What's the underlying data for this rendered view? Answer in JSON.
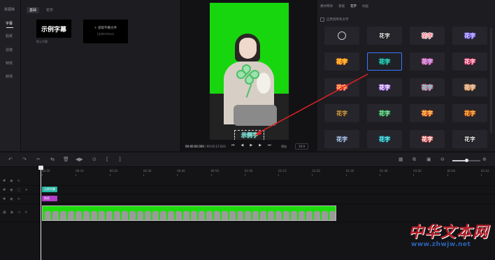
{
  "rail": {
    "title": "资源库",
    "items": [
      "字幕",
      "贴纸",
      "滤镜",
      "特效",
      "转场"
    ]
  },
  "resource": {
    "tabs": [
      "基础",
      "花字"
    ],
    "sample_title": "示例字幕",
    "sample_caption": "默认字幕",
    "extract_line1": "+ 提取字幕文件",
    "extract_line2": "(支持srt/ass)"
  },
  "preview": {
    "subtitle_text": "示例字",
    "time_current": "00:00:00.000",
    "time_total": "/ 00:02:27.833",
    "controls": [
      "⏮",
      "◀",
      "▶",
      "▶",
      "⏭"
    ],
    "original_label": "原始",
    "ratio_label": "16:9"
  },
  "right_panel": {
    "tabs": [
      "素材特效",
      "基础",
      "花字",
      "动画"
    ],
    "active_tab": "花字",
    "apply_all": "应用到所有文字",
    "styles": [
      {
        "text": "",
        "icon": "none-icon",
        "fg": "#c9c9cf"
      },
      {
        "text": "花字",
        "fg": "#ffffff",
        "bd": "#000000"
      },
      {
        "text": "花字",
        "fg": "#ff6b7f",
        "bd": "#ffffff"
      },
      {
        "text": "花字",
        "fg": "#c7d8ff",
        "bd": "#7a4fe0"
      },
      {
        "text": "花字",
        "fg": "#ffd63d",
        "bd": "#ff7a1c"
      },
      {
        "text": "花字",
        "fg": "#3ee0c2",
        "bd": "#0d6b64"
      },
      {
        "text": "花字",
        "fg": "#a8c4ff",
        "bd": "#ff52b0"
      },
      {
        "text": "花字",
        "fg": "#ffe6ef",
        "bd": "#e0245a"
      },
      {
        "text": "花字",
        "fg": "#ffd23d",
        "bd": "#ff3a6e"
      },
      {
        "text": "花字",
        "fg": "#ffffff",
        "bd": "#8c4fd6"
      },
      {
        "text": "花字",
        "fg": "#51e0c0",
        "bd": "#ff6fae"
      },
      {
        "text": "花字",
        "fg": "#c8d3e6",
        "bd": "#ff9a3a"
      },
      {
        "text": "花字",
        "fg": "#d8a85a",
        "bd": "#3a2a12"
      },
      {
        "text": "花字",
        "fg": "#8df0a8",
        "bd": "#1f6b3a"
      },
      {
        "text": "花字",
        "fg": "#ffe067",
        "bd": "#e24a1c"
      },
      {
        "text": "花字",
        "fg": "#ffd24a",
        "bd": "#b63a14"
      },
      {
        "text": "花字",
        "fg": "#c8d6ee",
        "bd": "#2a3a55"
      },
      {
        "text": "花字",
        "fg": "#6ef0ef",
        "bd": "#0e6b7a"
      },
      {
        "text": "花字",
        "fg": "#ffffff",
        "bd": "#d94444"
      },
      {
        "text": "花字",
        "fg": "#ffffff",
        "bd": "#000000"
      }
    ],
    "selected_index": 5
  },
  "toolbar": {
    "tools": [
      "↶",
      "↷",
      "✂",
      "⇆",
      "🗑",
      "◀▶",
      "⊙",
      "[",
      "]"
    ]
  },
  "timeline": {
    "ticks": [
      "00:00",
      "00:10",
      "00:20",
      "00:30",
      "00:40",
      "00:50",
      "01:00",
      "01:10",
      "01:20",
      "01:30",
      "01:40",
      "01:50",
      "02:00",
      "02:10"
    ],
    "text_clip": "示例字幕",
    "sticker_clip": "贴纸"
  },
  "watermark": {
    "big": "中华文本网",
    "url": "www.zhwjw.net"
  }
}
